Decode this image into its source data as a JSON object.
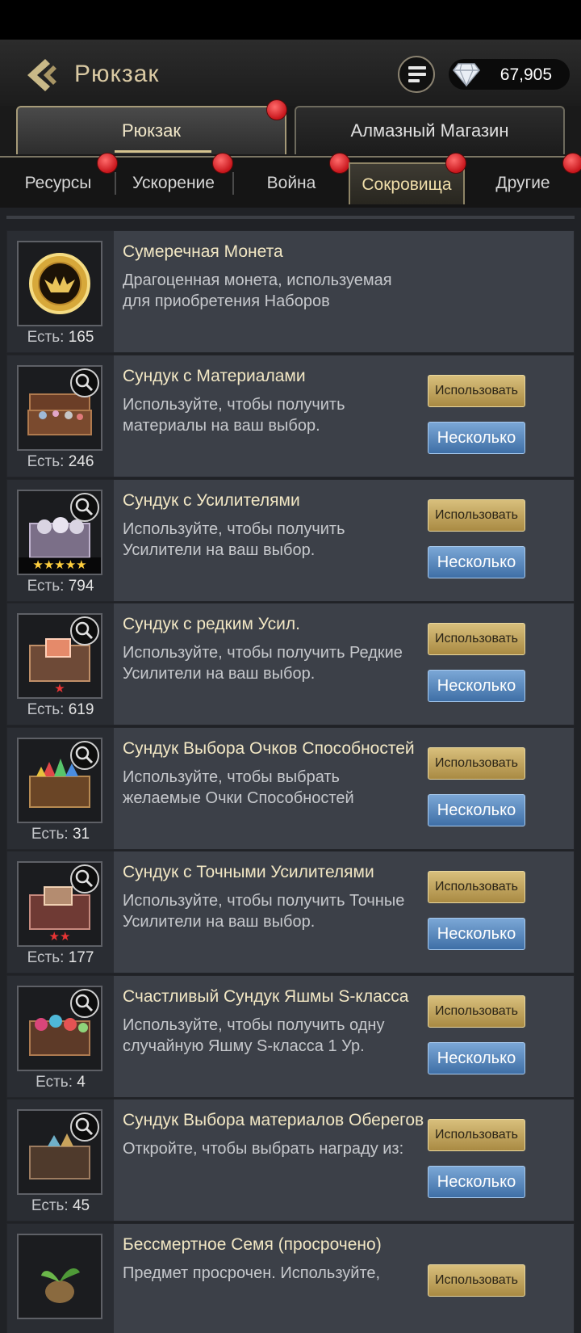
{
  "header": {
    "title": "Рюкзак",
    "gems": "67,905"
  },
  "main_tabs": [
    {
      "label": "Рюкзак",
      "active": true
    },
    {
      "label": "Алмазный Магазин",
      "active": false
    }
  ],
  "sub_tabs": [
    {
      "label": "Ресурсы"
    },
    {
      "label": "Ускорение"
    },
    {
      "label": "Война"
    },
    {
      "label": "Сокровища",
      "active": true
    },
    {
      "label": "Другие"
    }
  ],
  "qty_label": "Есть:",
  "buttons": {
    "use": "Использовать",
    "multi": "Несколько"
  },
  "items": [
    {
      "name": "Сумеречная Монета",
      "desc": "Драгоценная монета, используемая для приобретения Наборов",
      "qty": "165",
      "icon": "twilight-coin-icon"
    },
    {
      "name": "Сундук с Материалами",
      "desc": "Используйте, чтобы получить материалы на ваш выбор.",
      "qty": "246",
      "icon": "materials-chest-icon"
    },
    {
      "name": "Сундук с Усилителями",
      "desc": "Используйте, чтобы получить Усилители на ваш выбор.",
      "qty": "794",
      "icon": "boosters-chest-icon",
      "stars": "★★★★★"
    },
    {
      "name": "Сундук с редким Усил.",
      "desc": "Используйте, чтобы получить Редкие Усилители на ваш выбор.",
      "qty": "619",
      "icon": "rare-booster-chest-icon",
      "stars": "★"
    },
    {
      "name": "Сундук Выбора Очков Способностей",
      "desc": "Используйте, чтобы выбрать желаемые Очки Способностей",
      "qty": "31",
      "icon": "ability-points-chest-icon"
    },
    {
      "name": "Сундук с Точными Усилителями",
      "desc": "Используйте, чтобы получить Точные Усилители на ваш выбор.",
      "qty": "177",
      "icon": "precise-booster-chest-icon",
      "stars": "★★"
    },
    {
      "name": "Счастливый Сундук Яшмы S-класса",
      "desc": "Используйте, чтобы получить одну случайную Яшму S-класса 1 Ур.",
      "qty": "4",
      "icon": "jasper-chest-icon"
    },
    {
      "name": "Сундук Выбора материалов Оберегов",
      "desc": "Откройте, чтобы выбрать награду из:",
      "qty": "45",
      "icon": "amulet-materials-chest-icon"
    },
    {
      "name": "Бессмертное Семя (просрочено)",
      "desc": "Предмет просрочен. Используйте,",
      "qty": "",
      "icon": "immortal-seed-icon"
    }
  ]
}
